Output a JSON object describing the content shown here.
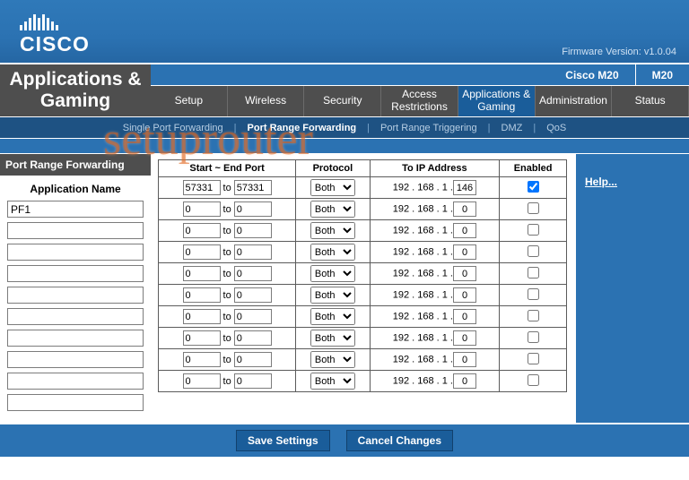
{
  "brand": "CISCO",
  "firmware_label": "Firmware Version: v1.0.04",
  "model_a": "Cisco M20",
  "model_b": "M20",
  "left_title": "Applications & Gaming",
  "tabs": [
    "Setup",
    "Wireless",
    "Security",
    "Access Restrictions",
    "Applications & Gaming",
    "Administration",
    "Status"
  ],
  "active_tab": 4,
  "subtabs": [
    "Single Port Forwarding",
    "Port Range Forwarding",
    "Port Range Triggering",
    "DMZ",
    "QoS"
  ],
  "active_sub": 1,
  "section": "Port Range Forwarding",
  "apps_label": "Application Name",
  "app_names": [
    "PF1",
    "",
    "",
    "",
    "",
    "",
    "",
    "",
    "",
    ""
  ],
  "headers": {
    "range": "Start ~ End Port",
    "proto": "Protocol",
    "ip": "To IP Address",
    "en": "Enabled"
  },
  "to_word": "to",
  "proto_value": "Both",
  "ip_prefix": "192 . 168 . 1 .",
  "rows": [
    {
      "start": "57331",
      "end": "57331",
      "ip": "146",
      "enabled": true
    },
    {
      "start": "0",
      "end": "0",
      "ip": "0",
      "enabled": false
    },
    {
      "start": "0",
      "end": "0",
      "ip": "0",
      "enabled": false
    },
    {
      "start": "0",
      "end": "0",
      "ip": "0",
      "enabled": false
    },
    {
      "start": "0",
      "end": "0",
      "ip": "0",
      "enabled": false
    },
    {
      "start": "0",
      "end": "0",
      "ip": "0",
      "enabled": false
    },
    {
      "start": "0",
      "end": "0",
      "ip": "0",
      "enabled": false
    },
    {
      "start": "0",
      "end": "0",
      "ip": "0",
      "enabled": false
    },
    {
      "start": "0",
      "end": "0",
      "ip": "0",
      "enabled": false
    },
    {
      "start": "0",
      "end": "0",
      "ip": "0",
      "enabled": false
    }
  ],
  "help": "Help...",
  "btn_save": "Save Settings",
  "btn_cancel": "Cancel Changes",
  "watermark": "setuprouter"
}
